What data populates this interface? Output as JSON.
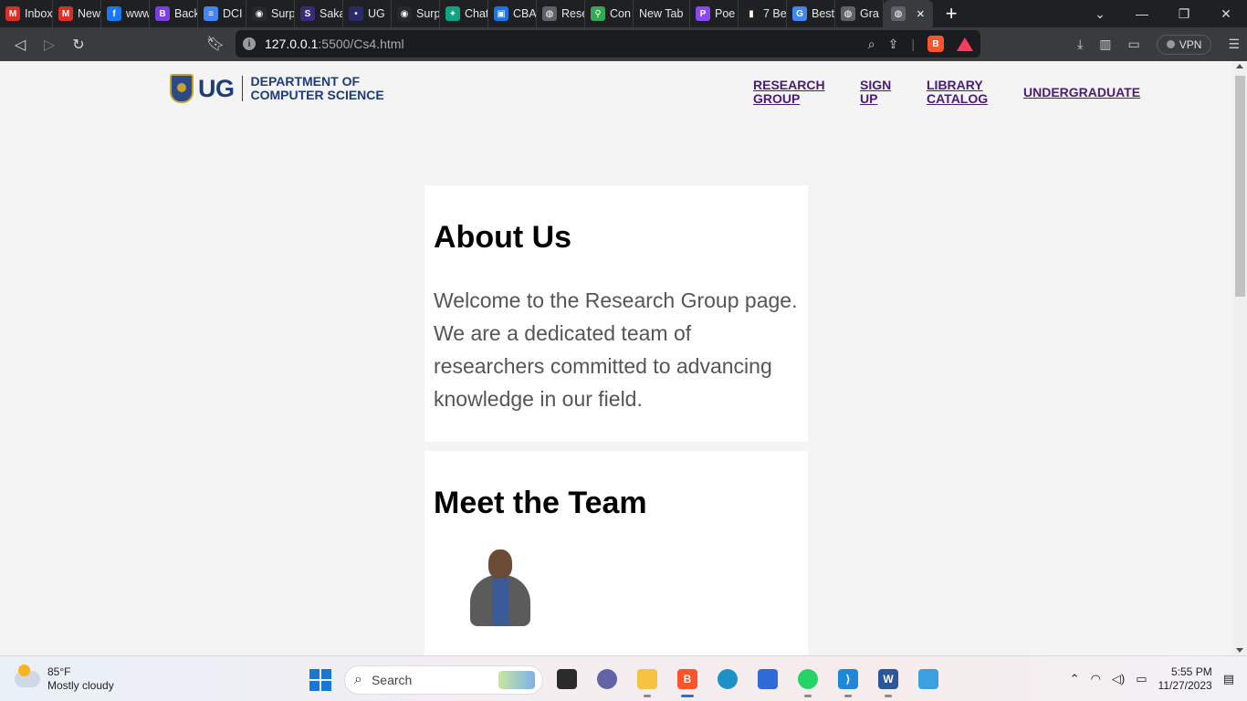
{
  "browser": {
    "tabs": [
      {
        "label": "Inbox",
        "icon": "gmail-icon",
        "color": "#d93025",
        "glyph": "M"
      },
      {
        "label": "New",
        "icon": "gmail-icon",
        "color": "#d93025",
        "glyph": "M"
      },
      {
        "label": "www",
        "icon": "facebook-icon",
        "color": "#1877f2",
        "glyph": "f"
      },
      {
        "label": "Back",
        "icon": "b-app-icon",
        "color": "#7b3fe4",
        "glyph": "B"
      },
      {
        "label": "DCI",
        "icon": "docs-icon",
        "color": "#4285f4",
        "glyph": "≡"
      },
      {
        "label": "Surp",
        "icon": "github-icon",
        "color": "#24292e",
        "glyph": "◉"
      },
      {
        "label": "Saka",
        "icon": "sakai-icon",
        "color": "#3b2a7a",
        "glyph": "S"
      },
      {
        "label": "UG",
        "icon": "ug-icon",
        "color": "#2a2a6a",
        "glyph": "•"
      },
      {
        "label": "Surp",
        "icon": "github-icon",
        "color": "#24292e",
        "glyph": "◉"
      },
      {
        "label": "Chat",
        "icon": "chatgpt-icon",
        "color": "#10a37f",
        "glyph": "✦"
      },
      {
        "label": "CBA",
        "icon": "contacts-icon",
        "color": "#1a73e8",
        "glyph": "▣"
      },
      {
        "label": "Rese",
        "icon": "globe-icon",
        "color": "#5f6368",
        "glyph": "◍"
      },
      {
        "label": "Con",
        "icon": "maps-icon",
        "color": "#34a853",
        "glyph": "⚲"
      },
      {
        "label": "New Tab",
        "icon": "",
        "color": "",
        "glyph": ""
      },
      {
        "label": "Poe",
        "icon": "poe-icon",
        "color": "#8a4af3",
        "glyph": "P"
      },
      {
        "label": "7 Be",
        "icon": "bookmark-icon",
        "color": "#222222",
        "glyph": "▮"
      },
      {
        "label": "Best",
        "icon": "google-icon",
        "color": "#4285f4",
        "glyph": "G"
      },
      {
        "label": "Gra",
        "icon": "globe-icon",
        "color": "#5f6368",
        "glyph": "◍"
      }
    ],
    "active_tab_close": "×",
    "new_tab": "+",
    "url_host": "127.0.0.1",
    "url_path": ":5500/Cs4.html",
    "vpn_label": "VPN"
  },
  "page": {
    "logo": {
      "ug": "UG",
      "dept_line1": "DEPARTMENT OF",
      "dept_line2": "COMPUTER SCIENCE"
    },
    "nav": [
      {
        "line1": "RESEARCH",
        "line2": "GROUP"
      },
      {
        "line1": "SIGN",
        "line2": "UP"
      },
      {
        "line1": "LIBRARY",
        "line2": "CATALOG"
      },
      {
        "line1": "UNDERGRADUATE",
        "line2": ""
      }
    ],
    "about": {
      "heading": "About Us",
      "body": "Welcome to the Research Group page. We are a dedicated team of researchers committed to advancing knowledge in our field."
    },
    "team": {
      "heading": "Meet the Team"
    }
  },
  "taskbar": {
    "weather_temp": "85°F",
    "weather_desc": "Mostly cloudy",
    "search_label": "Search",
    "time": "5:55 PM",
    "date": "11/27/2023"
  },
  "colors": {
    "nav_link": "#4b1a7a",
    "logo": "#1e3c7a",
    "card": "#ffffff",
    "page_bg": "#f4f4f4"
  }
}
